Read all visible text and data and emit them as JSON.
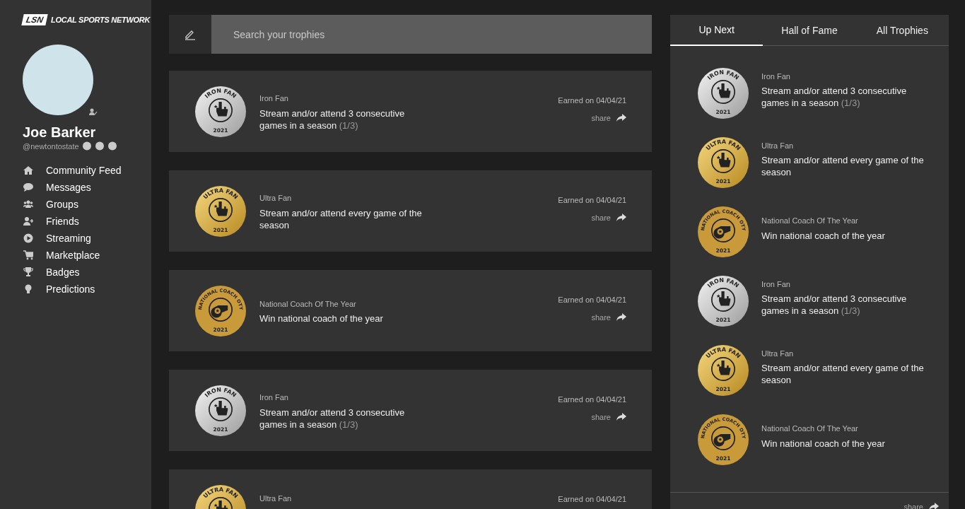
{
  "brand": {
    "mark": "LSN",
    "name": "LOCAL SPORTS NETWORK"
  },
  "profile": {
    "name": "Joe Barker",
    "handle": "@newtontostate"
  },
  "nav": [
    {
      "label": "Community Feed"
    },
    {
      "label": "Messages"
    },
    {
      "label": "Groups"
    },
    {
      "label": "Friends"
    },
    {
      "label": "Streaming"
    },
    {
      "label": "Marketplace"
    },
    {
      "label": "Badges"
    },
    {
      "label": "Predictions"
    }
  ],
  "search": {
    "placeholder": "Search your trophies"
  },
  "trophies": [
    {
      "title": "Iron Fan",
      "description": "Stream and/or attend 3 consecutive games in a season",
      "progress": "(1/3)",
      "earned": "Earned on 04/04/21",
      "share": "share",
      "badge": {
        "kind": "silver",
        "label": "IRON FAN",
        "year": "2021"
      }
    },
    {
      "title": "Ultra Fan",
      "description": "Stream and/or attend every game of the season",
      "earned": "Earned on 04/04/21",
      "share": "share",
      "badge": {
        "kind": "gold",
        "label": "ULTRA FAN",
        "year": "2021"
      }
    },
    {
      "title": "National Coach Of The Year",
      "description": "Win national coach of the year",
      "earned": "Earned on 04/04/21",
      "share": "share",
      "badge": {
        "kind": "bronze",
        "label": "NATIONAL COACH OTY",
        "year": "2021"
      }
    },
    {
      "title": "Iron Fan",
      "description": "Stream and/or attend 3 consecutive games in a season",
      "progress": "(1/3)",
      "earned": "Earned on 04/04/21",
      "share": "share",
      "badge": {
        "kind": "silver",
        "label": "IRON FAN",
        "year": "2021"
      }
    },
    {
      "title": "Ultra Fan",
      "earned": "Earned on 04/04/21",
      "badge": {
        "kind": "gold",
        "label": "ULTRA FAN"
      }
    }
  ],
  "tabs": [
    {
      "label": "Up Next",
      "selected": true
    },
    {
      "label": "Hall of Fame",
      "selected": false
    },
    {
      "label": "All Trophies",
      "selected": false
    }
  ],
  "up_next": [
    {
      "title": "Iron Fan",
      "description": "Stream and/or attend 3 consecutive games in a season",
      "progress": "(1/3)",
      "badge": {
        "kind": "silver",
        "label": "IRON FAN",
        "year": "2021"
      }
    },
    {
      "title": "Ultra Fan",
      "description": "Stream and/or attend every game of the season",
      "badge": {
        "kind": "gold",
        "label": "ULTRA FAN",
        "year": "2021"
      }
    },
    {
      "title": "National Coach Of The Year",
      "description": "Win national coach of the year",
      "badge": {
        "kind": "bronze",
        "label": "NATIONAL COACH OTY",
        "year": "2021"
      }
    },
    {
      "title": "Iron Fan",
      "description": "Stream and/or attend 3 consecutive games in a season",
      "progress": "(1/3)",
      "badge": {
        "kind": "silver",
        "label": "IRON FAN",
        "year": "2021"
      }
    },
    {
      "title": "Ultra Fan",
      "description": "Stream and/or attend every game of the season",
      "badge": {
        "kind": "gold",
        "label": "ULTRA FAN",
        "year": "2021"
      }
    },
    {
      "title": "National Coach Of The Year",
      "description": "Win national coach of the year",
      "badge": {
        "kind": "bronze",
        "label": "NATIONAL COACH OTY",
        "year": "2021"
      }
    }
  ],
  "panel_share": "share"
}
